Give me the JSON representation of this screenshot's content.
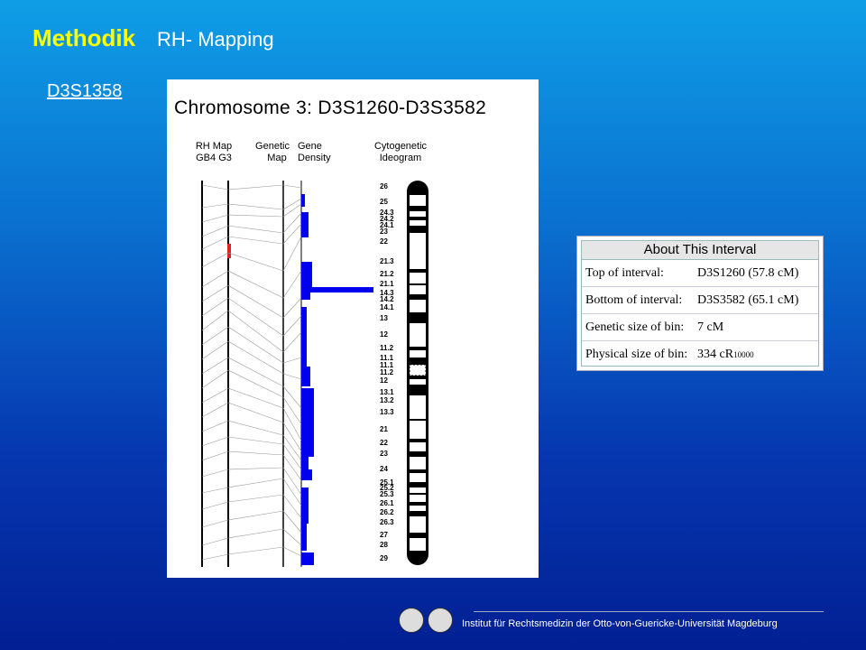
{
  "header": {
    "title": "Methodik",
    "subtitle": "RH- Mapping"
  },
  "marker_link": "D3S1358",
  "figure": {
    "title": "Chromosome 3: D3S1260-D3S3582",
    "columns": {
      "rh_map_line1": "RH Map",
      "rh_map_line2": "GB4   G3",
      "genetic_map_line1": "Genetic",
      "genetic_map_line2": "Map",
      "gene_density_line1": "Gene",
      "gene_density_line2": "Density",
      "ideogram_line1": "Cytogenetic",
      "ideogram_line2": "Ideogram"
    },
    "bands": [
      "26",
      "25",
      "24.3",
      "24.2",
      "24.1",
      "23",
      "22",
      "21.3",
      "21.2",
      "21.1",
      "14.3",
      "14.2",
      "14.1",
      "13",
      "12",
      "11.2",
      "11.1",
      "11.1",
      "11.2",
      "12",
      "13.1",
      "13.2",
      "13.3",
      "21",
      "22",
      "23",
      "24",
      "25.1",
      "25.2",
      "25.3",
      "26.1",
      "26.2",
      "26.3",
      "27",
      "28",
      "29"
    ]
  },
  "about_interval": {
    "title": "About This Interval",
    "rows": [
      {
        "label": "Top of interval:",
        "value": "D3S1260 (57.8 cM)"
      },
      {
        "label": "Bottom of interval:",
        "value": "D3S3582 (65.1 cM)"
      },
      {
        "label": "Genetic size of bin:",
        "value": "7 cM"
      },
      {
        "label": "Physical size of bin:",
        "value": "334 cR",
        "value_sub": "10000"
      }
    ]
  },
  "footer": {
    "institution": "Institut für Rechtsmedizin der Otto-von-Guericke-Universität  Magdeburg"
  },
  "colors": {
    "title": "#ffff00",
    "density_bar": "#0000ee",
    "rh_highlight": "#dd2222"
  }
}
